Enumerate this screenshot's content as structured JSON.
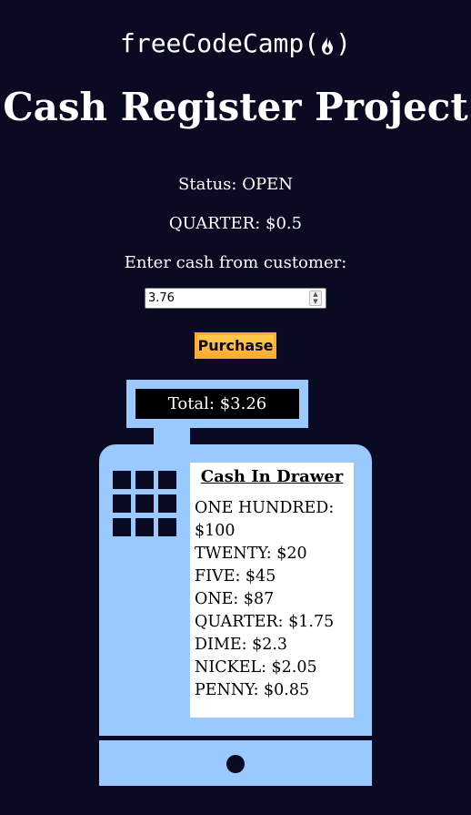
{
  "logo": {
    "text": "freeCodeCamp(",
    "text_end": ")",
    "icon": "fire-icon"
  },
  "page_title": "Cash Register Project",
  "change_due": {
    "status": "Status: OPEN",
    "quarter": "QUARTER: $0.5"
  },
  "cash_input": {
    "label": "Enter cash from customer:",
    "value": "3.76"
  },
  "purchase_button": {
    "label": "Purchase"
  },
  "register": {
    "total": "Total: $3.26",
    "drawer_title": "Cash In Drawer",
    "drawer_items": [
      "ONE HUNDRED: $100",
      "TWENTY: $20",
      "FIVE: $45",
      "ONE: $87",
      "QUARTER: $1.75",
      "DIME: $2.3",
      "NICKEL: $2.05",
      "PENNY: $0.85"
    ]
  },
  "colors": {
    "background": "#0a0a23",
    "register": "#99c9ff",
    "button": "#feac32"
  }
}
